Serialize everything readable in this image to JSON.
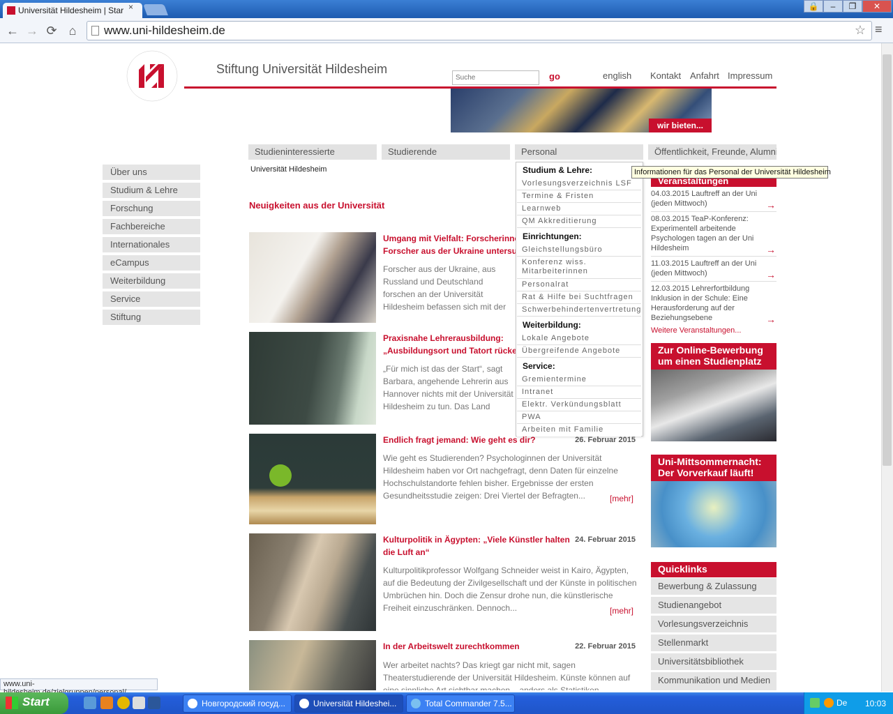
{
  "browser": {
    "tab_title": "Universität Hildesheim | Star",
    "tab_close": "×",
    "url": "www.uni-hildesheim.de",
    "status_url": "www.uni-hildesheim.de/zielgruppen/personal/",
    "window_buttons": [
      "🔒",
      "–",
      "❐",
      "✕"
    ],
    "nav": {
      "back": "←",
      "forward": "→",
      "reload": "⟳",
      "home": "⌂",
      "star": "☆",
      "menu": "≡"
    }
  },
  "header": {
    "logo_text": "Stiftung Universität Hildesheim 2003",
    "site_title": "Stiftung Universität Hildesheim",
    "search_placeholder": "Suche",
    "go": "go",
    "links": [
      "english",
      "Kontakt",
      "Anfahrt",
      "Impressum"
    ],
    "banner_button": "wir bieten..."
  },
  "mainnav": [
    "Studieninteressierte",
    "Studierende",
    "Personal",
    "Öffentlichkeit, Freunde, Alumni"
  ],
  "sidenav": [
    "Über uns",
    "Studium & Lehre",
    "Forschung",
    "Fachbereiche",
    "Internationales",
    "eCampus",
    "Weiterbildung",
    "Service",
    "Stiftung"
  ],
  "breadcrumb": "Universität Hildesheim",
  "news": {
    "heading": "Neuigkeiten aus der Universität",
    "more_label": "[mehr]",
    "items": [
      {
        "title": "Umgang mit Vielfalt: Forscherinnen und Forscher aus der Ukraine untersuchen Beziehungen zu Russland und Ukraine",
        "date": "",
        "body": "Forscher aus der Ukraine, aus Russland und Deutschland forschen an der Universität Hildesheim befassen sich mit der Frage, wie die Menschen mit ethnischer Vielfalt zurechtkommen, wie sie mit Minderheiten und Nachbarn umgehen. „Es wäre schlimm, wenn..."
      },
      {
        "title": "Praxisnahe Lehrerausbildung: „Ausbildungsort und Tatort rücken zusammen“",
        "date": "",
        "body": "„Für mich ist das der Start“, sagt Barbara, angehende Lehrerin aus Hannover nichts mit der Universität Hildesheim zu tun. Das Land Niedersachsen möchte Theorie und Praxis..."
      },
      {
        "title": "Endlich fragt jemand: Wie geht es dir?",
        "date": "26. Februar 2015",
        "body": "Wie geht es Studierenden? Psychologinnen der Universität Hildesheim haben vor Ort nachgefragt, denn Daten für einzelne Hochschulstandorte fehlen bisher. Ergebnisse der ersten Gesundheitsstudie zeigen: Drei Viertel der Befragten..."
      },
      {
        "title": "Kulturpolitik in Ägypten: „Viele Künstler halten die Luft an“",
        "date": "24. Februar 2015",
        "body": "Kulturpolitikprofessor Wolfgang Schneider weist in Kairo, Ägypten, auf die Bedeutung der Zivilgesellschaft und der Künste in politischen Umbrüchen hin. Doch die Zensur drohe nun, die künstlerische Freiheit einzuschränken. Dennoch..."
      },
      {
        "title": "In der Arbeitswelt zurechtkommen",
        "date": "22. Februar 2015",
        "body": "Wer arbeitet nachts? Das kriegt gar nicht mit, sagen Theaterstudierende der Universität Hildesheim. Künste können auf eine sinnliche Art sichtbar machen – anders als Statistiken"
      }
    ]
  },
  "dropdown": {
    "tooltip": "Informationen für das Personal der Universität Hildesheim",
    "sections": [
      {
        "head": "Studium & Lehre:",
        "items": [
          "Vorlesungsverzeichnis LSF",
          "Termine & Fristen",
          "Learnweb",
          "QM Akkreditierung"
        ]
      },
      {
        "head": "Einrichtungen:",
        "items": [
          "Gleichstellungsbüro",
          "Konferenz wiss. Mitarbeiterinnen",
          "Personalrat",
          "Rat & Hilfe bei Suchtfragen",
          "Schwerbehindertenvertretung"
        ]
      },
      {
        "head": "Weiterbildung:",
        "items": [
          "Lokale Angebote",
          "Übergreifende Angebote"
        ]
      },
      {
        "head": "Service:",
        "items": [
          "Gremientermine",
          "Intranet",
          "Elektr. Verkündungsblatt",
          "PWA",
          "Arbeiten mit Familie"
        ]
      }
    ]
  },
  "events": {
    "heading": "Veranstaltungen",
    "items": [
      "04.03.2015 Lauftreff an der Uni (jeden Mittwoch)",
      "08.03.2015 TeaP-Konferenz: Experimentell arbeitende Psychologen tagen an der Uni Hildesheim",
      "11.03.2015 Lauftreff an der Uni (jeden Mittwoch)",
      "12.03.2015 Lehrerfortbildung Inklusion in der Schule: Eine Herausforderung auf der Beziehungsebene"
    ],
    "arrow": "→",
    "more": "Weitere Veranstaltungen..."
  },
  "promo": {
    "bewerbung": "Zur Online-Bewerbung um einen Studienplatz",
    "sommernacht": "Uni-Mittsommernacht: Der Vorverkauf läuft!"
  },
  "quicklinks": {
    "heading": "Quicklinks",
    "items": [
      "Bewerbung & Zulassung",
      "Studienangebot",
      "Vorlesungsverzeichnis",
      "Stellenmarkt",
      "Universitätsbibliothek",
      "Kommunikation und Medien"
    ]
  },
  "taskbar": {
    "start": "Start",
    "tasks": [
      "Новгородский госуд...",
      "Universität Hildeshei...",
      "Total Commander 7.5..."
    ],
    "lang": "De",
    "clock": "10:03"
  },
  "colors": {
    "accent": "#c8102e",
    "nav_bg": "#e5e5e5"
  }
}
